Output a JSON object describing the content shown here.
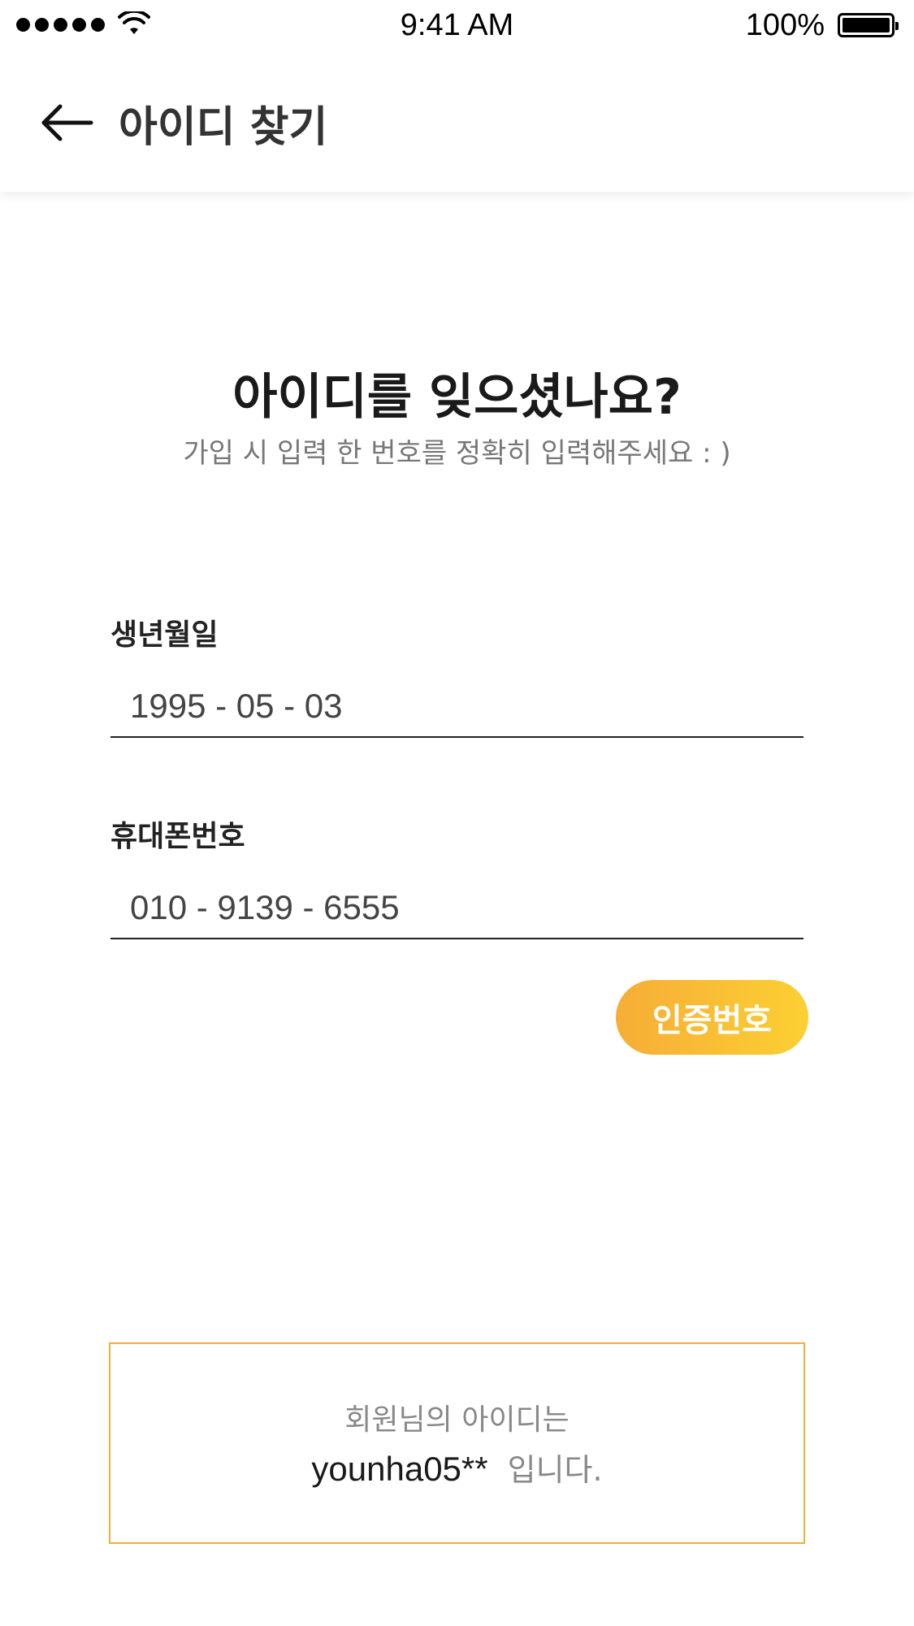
{
  "status_bar": {
    "time": "9:41 AM",
    "battery_percent": "100%"
  },
  "app_bar": {
    "title": "아이디 찾기",
    "back_icon": "arrow-left-icon"
  },
  "heading": {
    "title": "아이디를 잊으셨나요?",
    "subtitle": "가입 시 입력 한 번호를 정확히 입력해주세요 : )"
  },
  "form": {
    "birthdate": {
      "label": "생년월일",
      "value": "1995 - 05 - 03"
    },
    "phone": {
      "label": "휴대폰번호",
      "value": "010 - 9139 - 6555"
    },
    "verify_button_label": "인증번호"
  },
  "result": {
    "line1": "회원님의 아이디는",
    "user_id": "younha05**",
    "suffix": "입니다."
  },
  "colors": {
    "accent_start": "#f6ad37",
    "accent_end": "#fcd032",
    "result_border": "#f3ad3c"
  }
}
